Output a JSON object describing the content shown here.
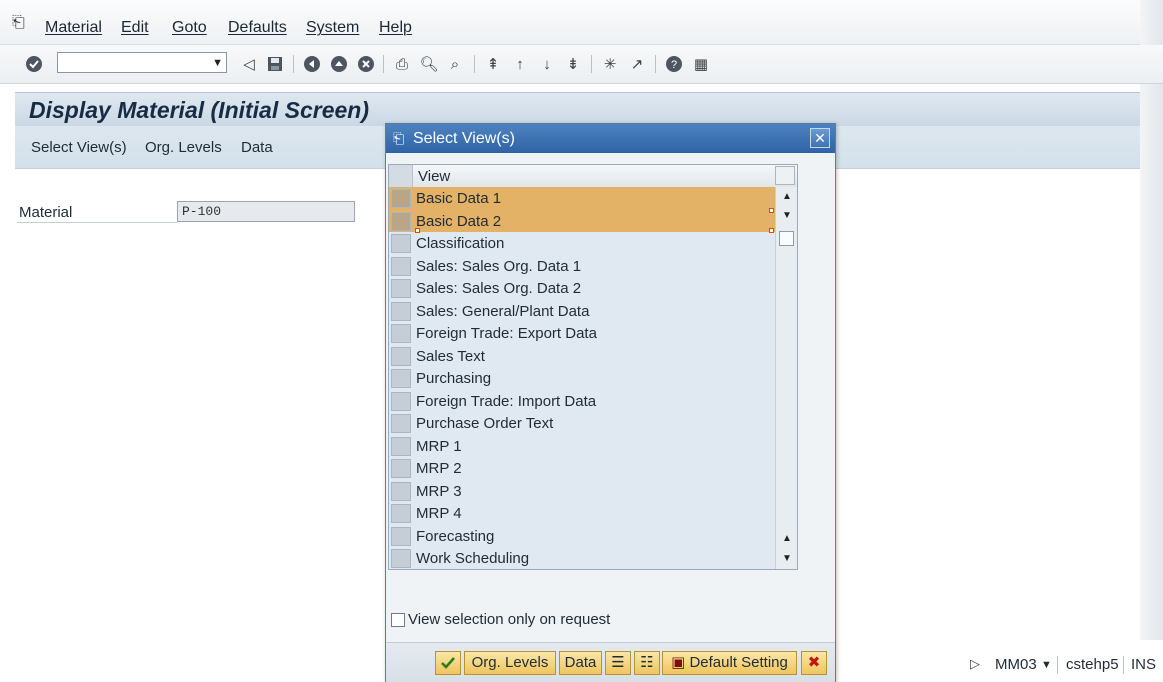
{
  "menubar": {
    "items": [
      "Material",
      "Edit",
      "Goto",
      "Defaults",
      "System",
      "Help"
    ]
  },
  "toolbar": {
    "command_field_value": "",
    "icons": [
      "check-icon",
      "back-icon",
      "save-icon",
      "nav-back-icon",
      "exit-icon",
      "cancel-icon",
      "print-icon",
      "find-icon",
      "find-next-icon",
      "first-page-icon",
      "prev-page-icon",
      "next-page-icon",
      "last-page-icon",
      "new-session-icon",
      "shortcut-icon",
      "help-icon",
      "layout-icon"
    ]
  },
  "page": {
    "title": "Display Material (Initial Screen)"
  },
  "app_toolbar": {
    "buttons": [
      "Select View(s)",
      "Org. Levels",
      "Data"
    ]
  },
  "form": {
    "material_label": "Material",
    "material_value": "P-100"
  },
  "dialog": {
    "title": "Select View(s)",
    "column_header": "View",
    "views": [
      {
        "label": "Basic Data 1",
        "selected": true
      },
      {
        "label": "Basic Data 2",
        "selected": true
      },
      {
        "label": "Classification",
        "selected": false
      },
      {
        "label": "Sales: Sales Org. Data 1",
        "selected": false
      },
      {
        "label": "Sales: Sales Org. Data 2",
        "selected": false
      },
      {
        "label": "Sales: General/Plant Data",
        "selected": false
      },
      {
        "label": "Foreign Trade: Export Data",
        "selected": false
      },
      {
        "label": "Sales Text",
        "selected": false
      },
      {
        "label": "Purchasing",
        "selected": false
      },
      {
        "label": "Foreign Trade: Import Data",
        "selected": false
      },
      {
        "label": "Purchase Order Text",
        "selected": false
      },
      {
        "label": "MRP 1",
        "selected": false
      },
      {
        "label": "MRP 2",
        "selected": false
      },
      {
        "label": "MRP 3",
        "selected": false
      },
      {
        "label": "MRP 4",
        "selected": false
      },
      {
        "label": "Forecasting",
        "selected": false
      },
      {
        "label": "Work Scheduling",
        "selected": false
      }
    ],
    "checkbox_label": "View selection only on request",
    "checkbox_checked": false,
    "footer": {
      "org_levels": "Org. Levels",
      "data": "Data",
      "default_setting": "Default Setting"
    }
  },
  "status": {
    "transaction": "MM03",
    "server": "cstehp5",
    "mode": "INS"
  },
  "colors": {
    "selection": "#e3b266",
    "dialog_title": "#2e64a6",
    "footer_button": "#efc55d"
  }
}
